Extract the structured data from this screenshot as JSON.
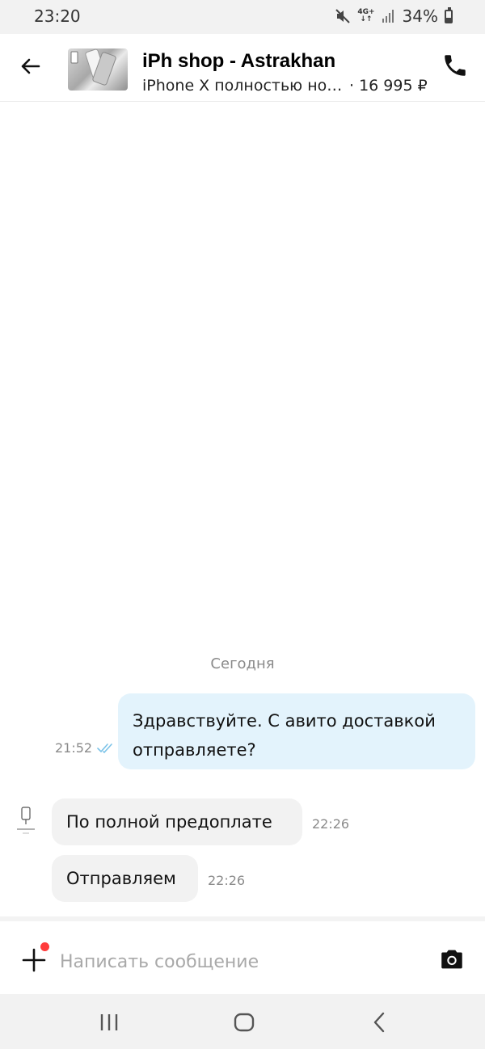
{
  "status_bar": {
    "time": "23:20",
    "network": "4G+",
    "battery": "34%",
    "battery_level": 0.34
  },
  "header": {
    "seller_name": "iPh shop - Astrakhan",
    "listing_title": "iPhone X полностью новый",
    "listing_price": "· 16 995 ₽"
  },
  "chat": {
    "date_separator": "Сегодня",
    "messages": [
      {
        "direction": "outgoing",
        "text": "Здравствуйте.  С авито доставкой отправляете?",
        "time": "21:52",
        "status": "read"
      },
      {
        "direction": "incoming",
        "text": "По полной предоплате",
        "time": "22:26"
      },
      {
        "direction": "incoming",
        "text": "Отправляем",
        "time": "22:26"
      }
    ]
  },
  "composer": {
    "placeholder": "Написать сообщение",
    "value": ""
  },
  "icons": {
    "back": "arrow-left-icon",
    "call": "phone-icon",
    "attach": "plus-icon",
    "camera": "camera-icon",
    "read_receipt": "double-check-icon",
    "mute": "muted-speaker-icon",
    "signal": "signal-bars-icon"
  },
  "colors": {
    "outgoing_bubble": "#e3f3fc",
    "incoming_bubble": "#f2f2f2",
    "read_check": "#7cc3e8",
    "attach_badge": "#ff3b3b"
  }
}
